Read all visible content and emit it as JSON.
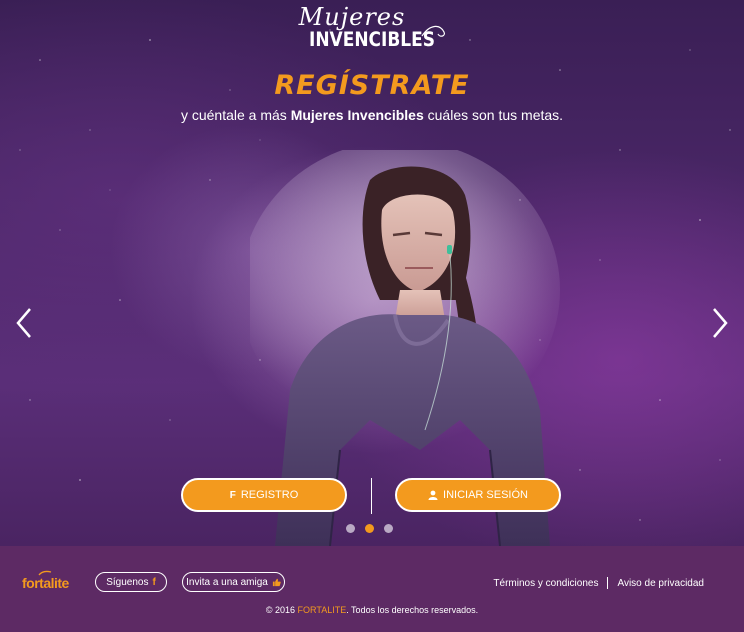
{
  "logo": {
    "script": "Mujeres",
    "main": "INVENCIBLES"
  },
  "hero": {
    "title": "REGÍSTRATE",
    "subtitle_pre": "y cuéntale a más ",
    "subtitle_bold": "Mujeres Invencibles",
    "subtitle_post": " cuáles son tus metas."
  },
  "buttons": {
    "register_label": "REGISTRO",
    "login_label": "INICIAR SESIÓN"
  },
  "carousel": {
    "slides": 3,
    "active_index": 1
  },
  "footer": {
    "brand": "fortalite",
    "follow_label": "Síguenos",
    "invite_label": "Invita a una amiga",
    "terms_label": "Términos y condiciones",
    "privacy_label": "Aviso de privacidad",
    "copyright_pre": "© 2016 ",
    "copyright_brand": "FORTALITE",
    "copyright_post": ". Todos los derechos reservados."
  },
  "colors": {
    "accent": "#f39a1e",
    "footer_bg": "#5d2a64",
    "hero_bg": "#4b2768"
  }
}
